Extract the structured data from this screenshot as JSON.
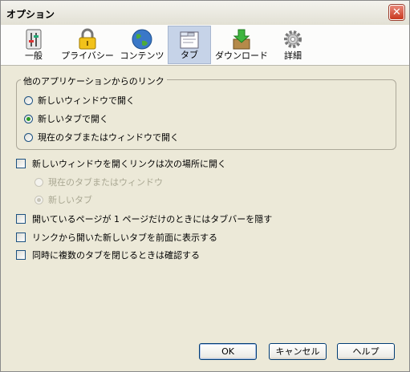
{
  "window": {
    "title": "オプション",
    "close_glyph": "✕"
  },
  "toolbar": {
    "tabs": [
      {
        "label": "一般",
        "icon": "sliders-icon",
        "selected": false
      },
      {
        "label": "プライバシー",
        "icon": "lock-icon",
        "selected": false
      },
      {
        "label": "コンテンツ",
        "icon": "globe-icon",
        "selected": false
      },
      {
        "label": "タブ",
        "icon": "tabs-window-icon",
        "selected": true
      },
      {
        "label": "ダウンロード",
        "icon": "download-box-icon",
        "selected": false
      },
      {
        "label": "詳細",
        "icon": "gear-icon",
        "selected": false
      }
    ]
  },
  "links_group": {
    "title": "他のアプリケーションからのリンク",
    "options": [
      {
        "label": "新しいウィンドウで開く",
        "selected": false
      },
      {
        "label": "新しいタブで開く",
        "selected": true
      },
      {
        "label": "現在のタブまたはウィンドウで開く",
        "selected": false
      }
    ]
  },
  "new_window_links": {
    "label": "新しいウィンドウを開くリンクは次の場所に開く",
    "checked": false,
    "sub_options": [
      {
        "label": "現在のタブまたはウィンドウ",
        "selected": false,
        "disabled": true
      },
      {
        "label": "新しいタブ",
        "selected": true,
        "disabled": true
      }
    ]
  },
  "checkboxes": [
    {
      "label": "開いているページが 1 ページだけのときにはタブバーを隠す",
      "checked": false
    },
    {
      "label": "リンクから開いた新しいタブを前面に表示する",
      "checked": false
    },
    {
      "label": "同時に複数のタブを閉じるときは確認する",
      "checked": false
    }
  ],
  "buttons": {
    "ok": "OK",
    "cancel": "キャンセル",
    "help": "ヘルプ"
  },
  "colors": {
    "dialog_bg": "#ece9d8",
    "selected_tab_bg": "#c6d3e8",
    "radio_dot": "#2a9a24",
    "close_button": "#c8381f"
  }
}
